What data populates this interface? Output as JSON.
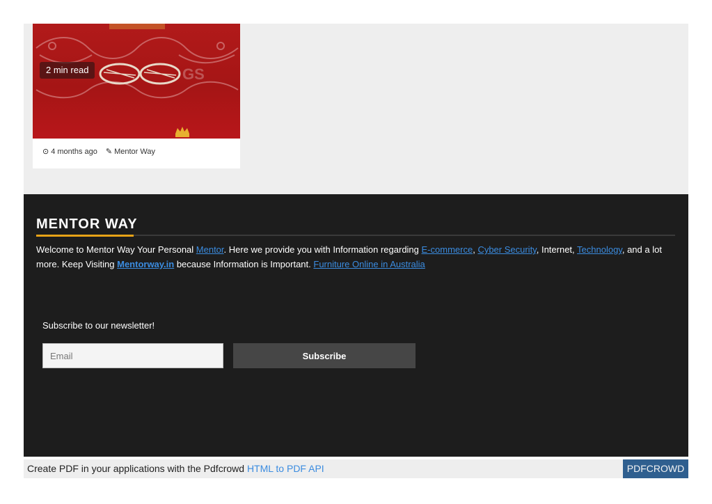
{
  "card": {
    "read_time": "2 min read",
    "date": "4 months ago",
    "author": "Mentor Way",
    "date_icon": "clock-icon",
    "author_icon": "edit-icon"
  },
  "footer": {
    "brand": "MENTOR WAY",
    "description": {
      "t1": "Welcome to Mentor Way Your Personal ",
      "link_mentor": "Mentor",
      "t2": ". Here we provide you with Information regarding ",
      "link_ecommerce": "E-commerce",
      "t3": ", ",
      "link_cyber": "Cyber Security",
      "t4": ", Internet, ",
      "link_technology": "Technology",
      "t5": ", and a lot more. Keep Visiting ",
      "link_site": "Mentorway.in",
      "t6": " because Information is Important. ",
      "link_furniture": "Furniture Online in Australia"
    },
    "newsletter": {
      "title": "Subscribe to our newsletter!",
      "email_placeholder": "Email",
      "email_value": "",
      "button_label": "Subscribe"
    }
  },
  "pdf_bar": {
    "text": "Create PDF in your applications with the Pdfcrowd ",
    "link": "HTML to PDF API",
    "button": "PDFCROWD"
  },
  "colors": {
    "accent": "#e8a317",
    "link": "#3b8ce0",
    "footer_bg": "#1d1d1d",
    "image_red": "#b11a1a"
  }
}
